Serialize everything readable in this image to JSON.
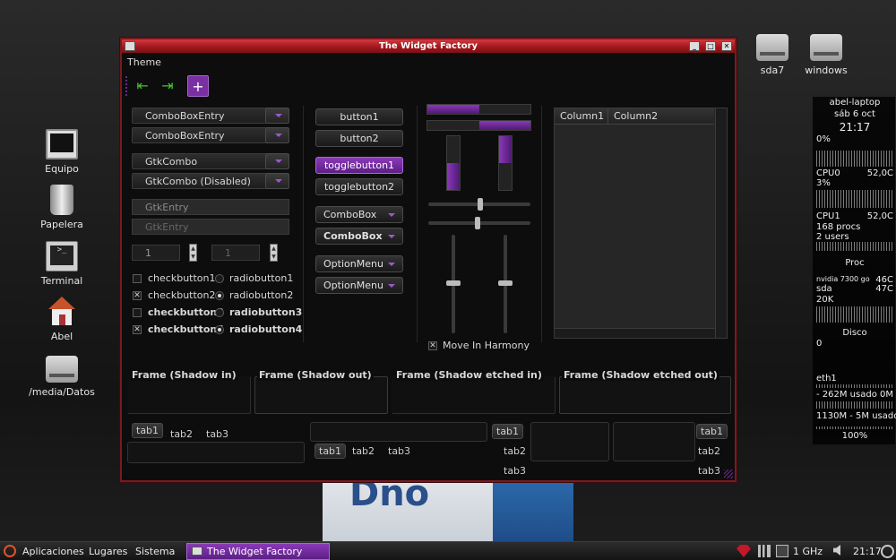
{
  "desktop": {
    "wallpaper_text": "Dno",
    "icons_left": [
      "Equipo",
      "Papelera",
      "Terminal",
      "Abel",
      "/media/Datos"
    ],
    "icons_right": [
      "sda7",
      "windows"
    ]
  },
  "window": {
    "title": "The Widget Factory",
    "menu": {
      "theme": "Theme"
    },
    "toolbar": {
      "back_icon": "go-first-icon",
      "forward_icon": "go-last-icon",
      "add": "+"
    },
    "combos": [
      {
        "label": "ComboBoxEntry"
      },
      {
        "label": "ComboBoxEntry"
      },
      {
        "label": "GtkCombo"
      },
      {
        "label": "GtkCombo (Disabled)"
      }
    ],
    "entries": [
      {
        "value": "GtkEntry"
      },
      {
        "value": "GtkEntry"
      }
    ],
    "spins": [
      {
        "value": "1"
      },
      {
        "value": "1"
      }
    ],
    "checks": [
      {
        "label": "checkbutton1",
        "checked": false
      },
      {
        "label": "checkbutton2",
        "checked": true
      },
      {
        "label": "checkbutton3",
        "checked": false
      },
      {
        "label": "checkbutton4",
        "checked": true
      }
    ],
    "check_mark": "✕",
    "radios": [
      {
        "label": "radiobutton1",
        "selected": false
      },
      {
        "label": "radiobutton2",
        "selected": true
      },
      {
        "label": "radiobutton3",
        "selected": false
      },
      {
        "label": "radiobutton4",
        "selected": true
      }
    ],
    "buttons": {
      "button1": "button1",
      "button2": "button2",
      "toggle1": "togglebutton1",
      "toggle2": "togglebutton2",
      "combobox1": "ComboBox",
      "combobox2": "ComboBox",
      "option1": "OptionMenu",
      "option2": "OptionMenu"
    },
    "progress": {
      "h1": 0.5,
      "h2": 0.5,
      "v1": 0.5,
      "v2": 0.5
    },
    "harmony": {
      "label": "Move In Harmony",
      "checked": true
    },
    "tree": {
      "col1": "Column1",
      "col2": "Column2"
    },
    "frames": [
      "Frame (Shadow in)",
      "Frame (Shadow out)",
      "Frame (Shadow etched in)",
      "Frame (Shadow etched out)"
    ],
    "tabs": [
      "tab1",
      "tab2",
      "tab3"
    ]
  },
  "conky": {
    "host": "abel-laptop",
    "date": "sáb  6 oct",
    "time": "21:17",
    "cpu_pct0": "0%",
    "cpu0": "CPU0",
    "cpu0_temp": "52,0C",
    "cpu_pct1": "3%",
    "cpu1": "CPU1",
    "cpu1_temp": "52,0C",
    "procs": "168 procs",
    "users": "2 users",
    "proc_title": "Proc",
    "gpu": "nvidia 7300 go",
    "gpu_temp": "46C",
    "sda": "sda",
    "sda_temp": "47C",
    "disk_scale": "20K",
    "disk_zero": "0",
    "disco": "Disco",
    "net_zero": "0",
    "eth": "eth1",
    "mem1": "- 262M usado  0M s",
    "mem2": "1130M - 5M usado",
    "battery": "100%"
  },
  "panel": {
    "apps": "Aplicaciones",
    "places": "Lugares",
    "system": "Sistema",
    "task": "The Widget Factory",
    "cpu_freq": "1 GHz",
    "clock": "21:17"
  },
  "colors": {
    "accent": "#8a39b8",
    "title_red": "#a3181f",
    "window_bg": "#0d0d0d"
  }
}
